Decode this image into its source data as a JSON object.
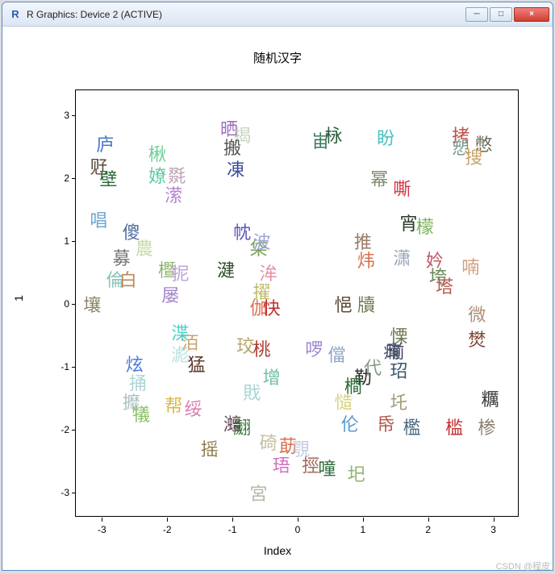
{
  "window": {
    "title": "R Graphics: Device 2 (ACTIVE)",
    "app_icon": "R",
    "buttons": {
      "min": "─",
      "max": "□",
      "close": "×"
    }
  },
  "watermark": "CSDN @程皮",
  "chart_data": {
    "type": "scatter",
    "title": "随机汉字",
    "xlabel": "Index",
    "ylabel": "1",
    "xlim": [
      -3.4,
      3.4
    ],
    "ylim": [
      -3.4,
      3.4
    ],
    "x_ticks": [
      -3,
      -2,
      -1,
      0,
      1,
      2,
      3
    ],
    "y_ticks": [
      -3,
      -2,
      -1,
      0,
      1,
      2,
      3
    ],
    "points": [
      {
        "x": -2.95,
        "y": 2.55,
        "char": "庐",
        "color": "#4a76c9"
      },
      {
        "x": -3.05,
        "y": 2.2,
        "char": "觃",
        "color": "#5a4a36"
      },
      {
        "x": -2.9,
        "y": 2.0,
        "char": "壁",
        "color": "#2e6d3b"
      },
      {
        "x": -3.05,
        "y": 1.35,
        "char": "唱",
        "color": "#6fa6cf"
      },
      {
        "x": -2.55,
        "y": 1.15,
        "char": "傻",
        "color": "#4f6fa0"
      },
      {
        "x": -2.35,
        "y": 0.9,
        "char": "農",
        "color": "#c4dca5"
      },
      {
        "x": -2.7,
        "y": 0.75,
        "char": "募",
        "color": "#777"
      },
      {
        "x": -2.8,
        "y": 0.4,
        "char": "倫",
        "color": "#88c3b9"
      },
      {
        "x": -2.6,
        "y": 0.4,
        "char": "白",
        "color": "#b85"
      },
      {
        "x": -3.15,
        "y": 0.0,
        "char": "壤",
        "color": "#8a8468"
      },
      {
        "x": -2.5,
        "y": -0.95,
        "char": "炫",
        "color": "#4a76e0"
      },
      {
        "x": -2.45,
        "y": -1.25,
        "char": "捅",
        "color": "#b0d5d9"
      },
      {
        "x": -2.55,
        "y": -1.55,
        "char": "攠",
        "color": "#a7c1c2"
      },
      {
        "x": -2.4,
        "y": -1.75,
        "char": "犠",
        "color": "#8abf66"
      },
      {
        "x": -2.15,
        "y": 2.4,
        "char": "楸",
        "color": "#6fcf97"
      },
      {
        "x": -2.15,
        "y": 2.05,
        "char": "嫽",
        "color": "#59c9a4"
      },
      {
        "x": -1.85,
        "y": 2.05,
        "char": "毲",
        "color": "#c0a5b6"
      },
      {
        "x": -1.9,
        "y": 1.75,
        "char": "潆",
        "color": "#b480d0"
      },
      {
        "x": -2.0,
        "y": 0.55,
        "char": "櫭",
        "color": "#8bb26b"
      },
      {
        "x": -1.8,
        "y": 0.5,
        "char": "抳",
        "color": "#c3a5d6"
      },
      {
        "x": -1.95,
        "y": 0.15,
        "char": "屡",
        "color": "#a385c9"
      },
      {
        "x": -1.8,
        "y": -0.45,
        "char": "渫",
        "color": "#4bd0c6"
      },
      {
        "x": -1.65,
        "y": -0.6,
        "char": "洦",
        "color": "#cba26f"
      },
      {
        "x": -1.8,
        "y": -0.8,
        "char": "滮",
        "color": "#b7e0de"
      },
      {
        "x": -1.55,
        "y": -0.95,
        "char": "猛",
        "color": "#5a3a2a"
      },
      {
        "x": -1.9,
        "y": -1.6,
        "char": "帮",
        "color": "#d9b84a"
      },
      {
        "x": -1.6,
        "y": -1.65,
        "char": "绥",
        "color": "#d97ab0"
      },
      {
        "x": -1.35,
        "y": -2.3,
        "char": "摇",
        "color": "#8f7a50"
      },
      {
        "x": -1.05,
        "y": 2.8,
        "char": "晒",
        "color": "#9a6fc0"
      },
      {
        "x": -0.85,
        "y": 2.7,
        "char": "揭",
        "color": "#c5d3c0"
      },
      {
        "x": -1.0,
        "y": 2.5,
        "char": "搬",
        "color": "#555"
      },
      {
        "x": -0.95,
        "y": 2.15,
        "char": "凍",
        "color": "#3a4aa0"
      },
      {
        "x": -0.85,
        "y": 1.15,
        "char": "帎",
        "color": "#5a55b5"
      },
      {
        "x": -0.6,
        "y": 0.9,
        "char": "柋",
        "color": "#7aa05a"
      },
      {
        "x": -0.55,
        "y": 1.0,
        "char": "波",
        "color": "#9ea5d9"
      },
      {
        "x": -1.1,
        "y": 0.55,
        "char": "湕",
        "color": "#2e4a2a"
      },
      {
        "x": -0.45,
        "y": 0.5,
        "char": "洠",
        "color": "#e58fa5"
      },
      {
        "x": -0.55,
        "y": 0.2,
        "char": "擢",
        "color": "#c0bb6a"
      },
      {
        "x": -0.6,
        "y": -0.05,
        "char": "伽",
        "color": "#d97050"
      },
      {
        "x": -0.4,
        "y": -0.05,
        "char": "快",
        "color": "#c03030"
      },
      {
        "x": -0.8,
        "y": -0.65,
        "char": "珓",
        "color": "#b6a46a"
      },
      {
        "x": -0.55,
        "y": -0.7,
        "char": "桃",
        "color": "#b03a30"
      },
      {
        "x": -0.4,
        "y": -1.15,
        "char": "增",
        "color": "#70c0a0"
      },
      {
        "x": -0.7,
        "y": -1.4,
        "char": "戝",
        "color": "#a8d6d6"
      },
      {
        "x": -1.0,
        "y": -1.9,
        "char": "灗",
        "color": "#5a3a48"
      },
      {
        "x": -0.85,
        "y": -1.95,
        "char": "翽",
        "color": "#3a703a"
      },
      {
        "x": -0.45,
        "y": -2.2,
        "char": "碕",
        "color": "#c8c0a0"
      },
      {
        "x": -0.15,
        "y": -2.25,
        "char": "莇",
        "color": "#d97050"
      },
      {
        "x": -0.25,
        "y": -2.55,
        "char": "珸",
        "color": "#d570c0"
      },
      {
        "x": -0.6,
        "y": -3.0,
        "char": "宮",
        "color": "#b0bba5"
      },
      {
        "x": 0.25,
        "y": -0.7,
        "char": "啰",
        "color": "#9a85d0"
      },
      {
        "x": 0.05,
        "y": -2.3,
        "char": "覨",
        "color": "#c5cbe0"
      },
      {
        "x": 0.2,
        "y": -2.55,
        "char": "挳",
        "color": "#a06a5a"
      },
      {
        "x": 0.45,
        "y": -2.6,
        "char": "噇",
        "color": "#2e6d3b"
      },
      {
        "x": 0.35,
        "y": 2.6,
        "char": "峀",
        "color": "#3b7a5a"
      },
      {
        "x": 0.55,
        "y": 2.7,
        "char": "栐",
        "color": "#2e5d3b"
      },
      {
        "x": 0.7,
        "y": 0.0,
        "char": "悒",
        "color": "#5a4a36"
      },
      {
        "x": 0.6,
        "y": -0.8,
        "char": "儅",
        "color": "#90a5c5"
      },
      {
        "x": 1.05,
        "y": 0.0,
        "char": "牘",
        "color": "#6a7a50"
      },
      {
        "x": 1.0,
        "y": 1.0,
        "char": "推",
        "color": "#9a7a6a"
      },
      {
        "x": 1.05,
        "y": 0.7,
        "char": "炜",
        "color": "#d97050"
      },
      {
        "x": 1.0,
        "y": -1.15,
        "char": "勒",
        "color": "#2a2a2a"
      },
      {
        "x": 0.85,
        "y": -1.3,
        "char": "橺",
        "color": "#2e6d3b"
      },
      {
        "x": 1.15,
        "y": -1.0,
        "char": "代",
        "color": "#879b89"
      },
      {
        "x": 0.7,
        "y": -1.55,
        "char": "慥",
        "color": "#d6d07a"
      },
      {
        "x": 0.8,
        "y": -1.9,
        "char": "伦",
        "color": "#5a9acf"
      },
      {
        "x": 0.9,
        "y": -2.7,
        "char": "圯",
        "color": "#8fb56f"
      },
      {
        "x": 1.35,
        "y": 2.65,
        "char": "盼",
        "color": "#4fc0c0"
      },
      {
        "x": 1.25,
        "y": 2.0,
        "char": "幂",
        "color": "#7a8a6a"
      },
      {
        "x": 1.6,
        "y": 1.85,
        "char": "嘶",
        "color": "#d03040"
      },
      {
        "x": 1.7,
        "y": 1.3,
        "char": "宵",
        "color": "#2a3a2a"
      },
      {
        "x": 1.6,
        "y": 0.75,
        "char": "潇",
        "color": "#9aa5b5"
      },
      {
        "x": 1.55,
        "y": -0.5,
        "char": "慄",
        "color": "#6a7a50"
      },
      {
        "x": 1.5,
        "y": -0.75,
        "char": "瑐",
        "color": "#4a3a60"
      },
      {
        "x": 1.45,
        "y": -0.75,
        "char": "痡",
        "color": "#4a5a70"
      },
      {
        "x": 1.55,
        "y": -1.05,
        "char": "玿",
        "color": "#3a5a6a"
      },
      {
        "x": 1.55,
        "y": -1.55,
        "char": "圫",
        "color": "#a59b7a"
      },
      {
        "x": 1.35,
        "y": -1.9,
        "char": "帋",
        "color": "#b05a4a"
      },
      {
        "x": 1.75,
        "y": -1.95,
        "char": "檻",
        "color": "#4a6a80"
      },
      {
        "x": 1.95,
        "y": 1.25,
        "char": "檬",
        "color": "#7ab55a"
      },
      {
        "x": 2.1,
        "y": 0.7,
        "char": "妗",
        "color": "#c05a6a"
      },
      {
        "x": 2.15,
        "y": 0.45,
        "char": "垮",
        "color": "#6a8a5a"
      },
      {
        "x": 2.25,
        "y": 0.3,
        "char": "塔",
        "color": "#b55a50"
      },
      {
        "x": 2.5,
        "y": 2.7,
        "char": "拷",
        "color": "#c05050"
      },
      {
        "x": 2.5,
        "y": 2.5,
        "char": "愬",
        "color": "#7a9a8a"
      },
      {
        "x": 2.85,
        "y": 2.55,
        "char": "憋",
        "color": "#6a6a5a"
      },
      {
        "x": 2.7,
        "y": 2.35,
        "char": "搜",
        "color": "#c9a26a"
      },
      {
        "x": 2.65,
        "y": 0.6,
        "char": "喃",
        "color": "#d0a080"
      },
      {
        "x": 2.75,
        "y": -0.15,
        "char": "微",
        "color": "#b0907a"
      },
      {
        "x": 2.75,
        "y": -0.55,
        "char": "燓",
        "color": "#804a3a"
      },
      {
        "x": 2.4,
        "y": -1.95,
        "char": "槛",
        "color": "#c03030"
      },
      {
        "x": 2.95,
        "y": -1.5,
        "char": "糲",
        "color": "#3a3a3a"
      },
      {
        "x": 2.9,
        "y": -1.95,
        "char": "椮",
        "color": "#8a7a6a"
      }
    ]
  }
}
